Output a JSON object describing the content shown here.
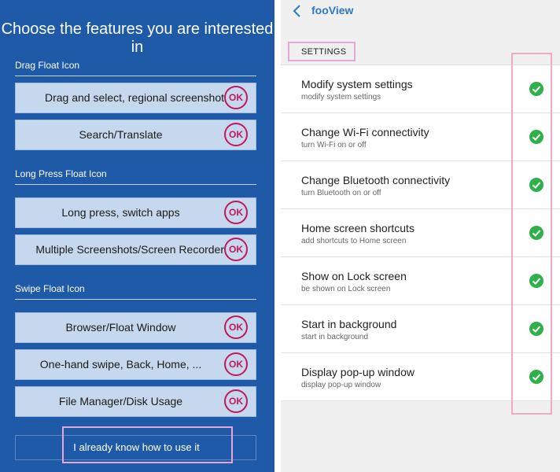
{
  "left": {
    "title": "Choose the features you are interested in",
    "sections": [
      {
        "label": "Drag Float Icon"
      },
      {
        "label": "Long Press Float Icon"
      },
      {
        "label": "Swipe Float Icon"
      }
    ],
    "buttons": [
      {
        "label": "Drag and select, regional screenshot",
        "badge": "OK"
      },
      {
        "label": "Search/Translate",
        "badge": "OK"
      },
      {
        "label": "Long press, switch apps",
        "badge": "OK"
      },
      {
        "label": "Multiple Screenshots/Screen Recorder",
        "badge": "OK"
      },
      {
        "label": "Browser/Float Window",
        "badge": "OK"
      },
      {
        "label": "One-hand swipe, Back, Home, ...",
        "badge": "OK"
      },
      {
        "label": "File Manager/Disk Usage",
        "badge": "OK"
      }
    ],
    "know_button": "I already know how to use it"
  },
  "right": {
    "app_title": "fooView",
    "back_icon": "chevron-left-icon",
    "settings_header": "SETTINGS",
    "items": [
      {
        "title": "Modify system settings",
        "subtitle": "modify system settings",
        "checked": true
      },
      {
        "title": "Change Wi-Fi connectivity",
        "subtitle": "turn Wi-Fi on or off",
        "checked": true
      },
      {
        "title": "Change Bluetooth connectivity",
        "subtitle": "turn Bluetooth on or off",
        "checked": true
      },
      {
        "title": "Home screen shortcuts",
        "subtitle": "add shortcuts to Home screen",
        "checked": true
      },
      {
        "title": "Show on Lock screen",
        "subtitle": "be shown on Lock screen",
        "checked": true
      },
      {
        "title": "Start in background",
        "subtitle": "start in background",
        "checked": true
      },
      {
        "title": "Display pop-up window",
        "subtitle": "display pop-up window",
        "checked": true
      }
    ]
  },
  "colors": {
    "left_background": "#1f5aa8",
    "button_fill": "#c5d8ee",
    "ok_badge": "#c2185b",
    "highlight_pink": "#e7a6d4",
    "app_title_blue": "#2d78c6",
    "check_green": "#2fb04a"
  }
}
